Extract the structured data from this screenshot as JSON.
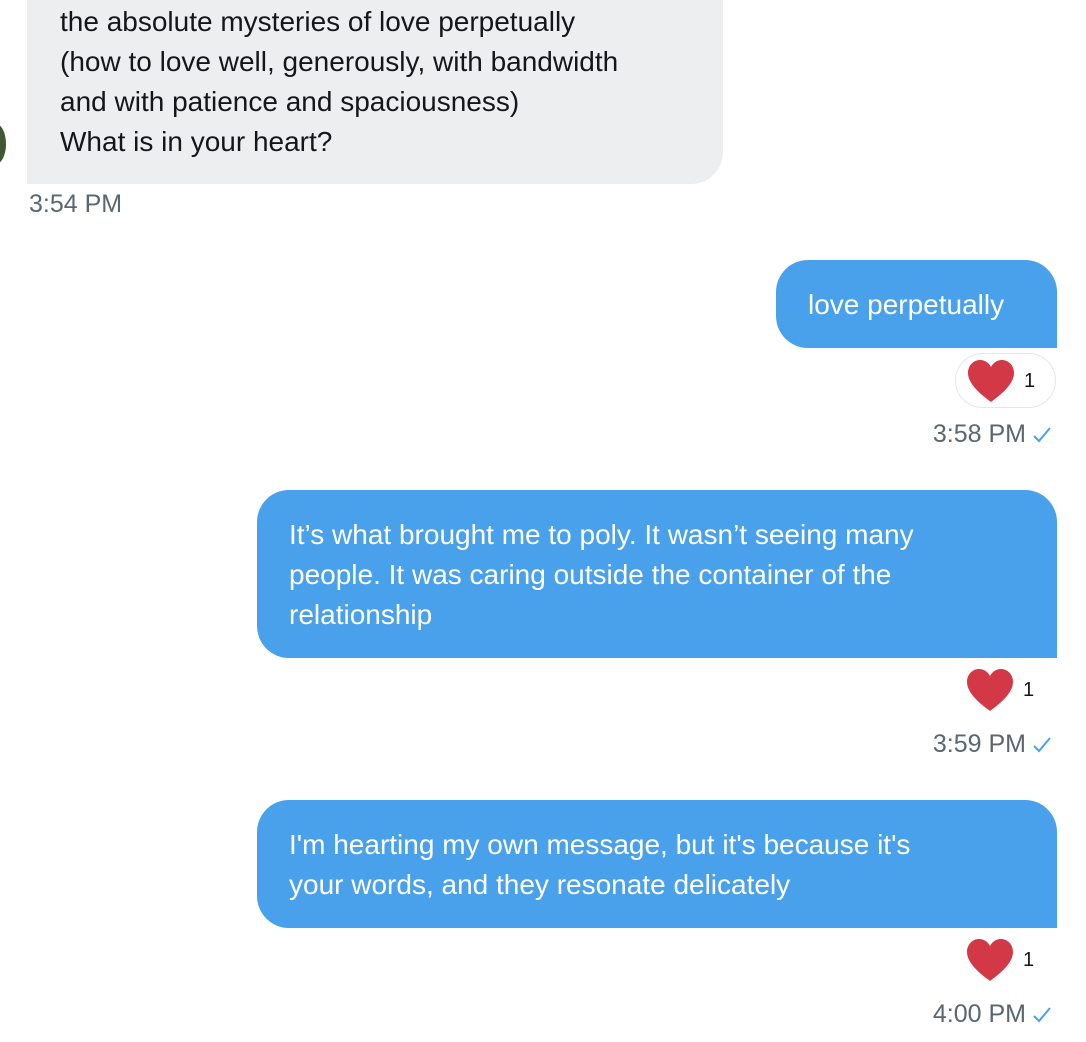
{
  "conversation": {
    "received": {
      "text": "the absolute mysteries of love perpetually\n(how to love well, generously, with bandwidth\nand with patience and spaciousness)\nWhat is in your heart?",
      "time": "3:54 PM"
    },
    "sent": [
      {
        "text": "love perpetually",
        "reaction_icon": "heart-icon",
        "reaction_count": "1",
        "time": "3:58 PM"
      },
      {
        "text": "It’s what brought me to poly. It wasn’t seeing many\npeople. It was caring outside the container of the\nrelationship",
        "reaction_icon": "heart-icon",
        "reaction_count": "1",
        "time": "3:59 PM"
      },
      {
        "text": "I'm hearting my own message, but it's because it's\nyour words, and they resonate delicately",
        "reaction_icon": "heart-icon",
        "reaction_count": "1",
        "time": "4:00 PM"
      }
    ]
  },
  "colors": {
    "sent_bubble": "#4aa1eb",
    "received_bubble": "#eceef0",
    "heart": "#d23845",
    "read_check": "#4aa1eb"
  },
  "icons": {
    "reaction": "heart-icon",
    "read_receipt": "checkmark-icon"
  }
}
